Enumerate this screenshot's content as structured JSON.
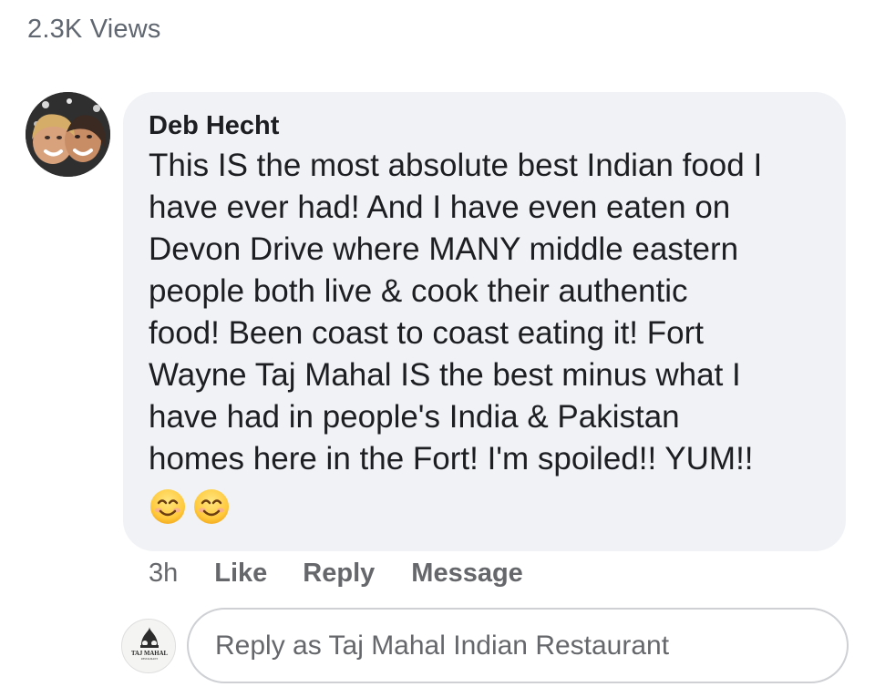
{
  "post": {
    "views": "2.3K Views"
  },
  "comment": {
    "author": "Deb Hecht",
    "text": "This IS the most absolute best Indian food I\nhave ever had!  And I have even eaten on\nDevon Drive where MANY middle eastern\npeople both live & cook their authentic\nfood!  Been coast to coast eating  it!  Fort\nWayne Taj Mahal IS the best minus what I\nhave had in people's India & Pakistan\nhomes here in the Fort!  I'm spoiled!!  YUM!!",
    "emojis": [
      "smiling-face-icon",
      "smiling-face-icon"
    ],
    "avatar_icon": "user-photo-avatar"
  },
  "actions": {
    "timestamp": "3h",
    "like": "Like",
    "reply": "Reply",
    "message": "Message"
  },
  "reply": {
    "placeholder": "Reply as Taj Mahal Indian Restaurant",
    "avatar_icon": "taj-mahal-logo",
    "logo_text": "TAJ MAHAL",
    "logo_subtext": "RESTAURANT"
  },
  "colors": {
    "text": "#1c1e21",
    "secondary_text": "#65676b",
    "bubble": "#f0f2f5",
    "input_border": "#ced0d4"
  }
}
